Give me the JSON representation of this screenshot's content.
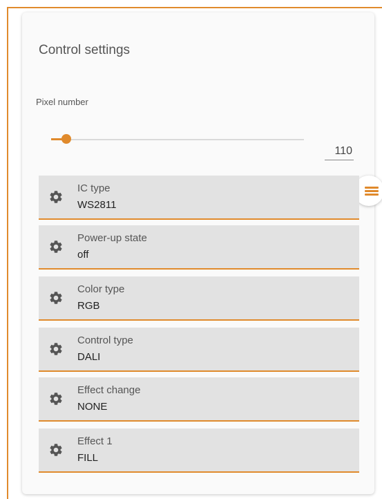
{
  "panel": {
    "title": "Control settings"
  },
  "pixel": {
    "label": "Pixel number",
    "value": "110",
    "slider_fraction": 0.06
  },
  "settings": [
    {
      "label": "IC type",
      "value": "WS2811",
      "icon": "gear-icon"
    },
    {
      "label": "Power-up state",
      "value": "off",
      "icon": "gear-icon"
    },
    {
      "label": "Color type",
      "value": "RGB",
      "icon": "gear-icon"
    },
    {
      "label": "Control type",
      "value": "DALI",
      "icon": "gear-icon"
    },
    {
      "label": "Effect change",
      "value": "NONE",
      "icon": "gear-icon"
    },
    {
      "label": "Effect 1",
      "value": "FILL",
      "icon": "gear-icon"
    }
  ],
  "menu": {
    "icon": "hamburger-menu-icon"
  },
  "colors": {
    "accent": "#e08a2c",
    "field_bg": "#e2e2e2",
    "card_bg": "#fafafa"
  }
}
